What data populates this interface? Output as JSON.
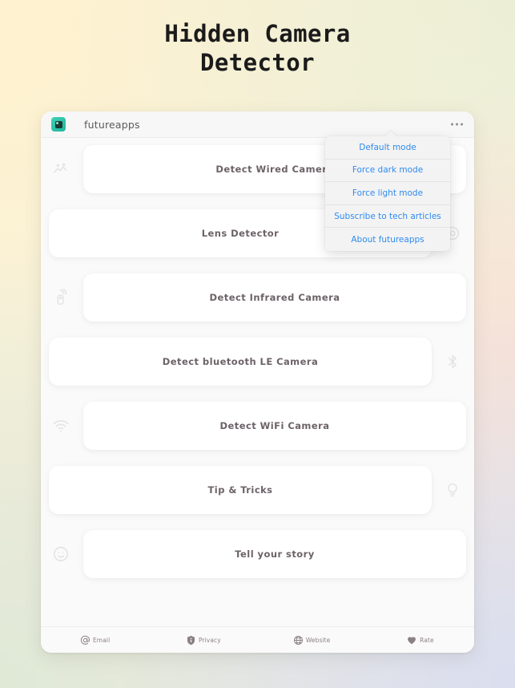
{
  "headline": {
    "line1": "Hidden Camera",
    "line2": "Detector"
  },
  "app_bar": {
    "app_name": "futureapps",
    "logo_icon": "camera-lens-icon",
    "overflow_icon": "more-options-icon"
  },
  "cards": [
    {
      "label": "Detect Wired Camera",
      "icon": "wired-signal-icon",
      "side": "right"
    },
    {
      "label": "Lens Detector",
      "icon": "lens-icon",
      "side": "left"
    },
    {
      "label": "Detect Infrared Camera",
      "icon": "remote-ir-icon",
      "side": "right"
    },
    {
      "label": "Detect bluetooth LE Camera",
      "icon": "bluetooth-icon",
      "side": "left"
    },
    {
      "label": "Detect WiFi Camera",
      "icon": "wifi-icon",
      "side": "right"
    },
    {
      "label": "Tip & Tricks",
      "icon": "lightbulb-icon",
      "side": "left"
    },
    {
      "label": "Tell your story",
      "icon": "smiley-face-icon",
      "side": "right"
    }
  ],
  "popup_menu": {
    "items": [
      {
        "label": "Default mode"
      },
      {
        "label": "Force dark mode"
      },
      {
        "label": "Force light mode"
      },
      {
        "label": "Subscribe to tech articles"
      },
      {
        "label": "About futureapps"
      }
    ]
  },
  "bottom_bar": {
    "items": [
      {
        "label": "Email",
        "icon": "at-sign-icon"
      },
      {
        "label": "Privacy",
        "icon": "shield-info-icon"
      },
      {
        "label": "Website",
        "icon": "globe-icon"
      },
      {
        "label": "Rate",
        "icon": "heart-icon"
      }
    ]
  },
  "colors": {
    "accent_blue": "#2f8bf0",
    "logo_teal": "#26c2a6",
    "card_text": "#6c6268",
    "app_background": "#fafafa"
  }
}
